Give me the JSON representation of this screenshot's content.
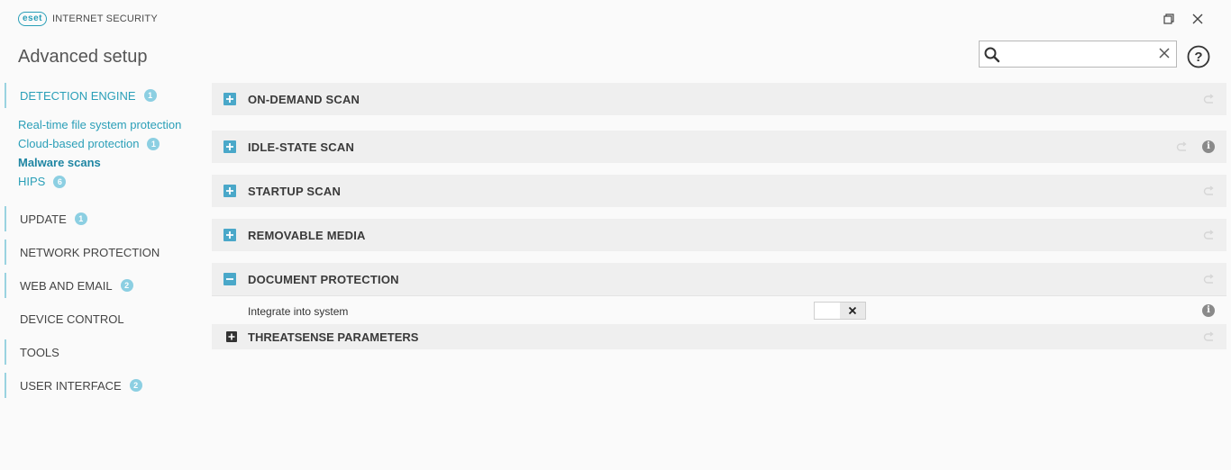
{
  "window": {
    "logo_text": "eset",
    "product_name": "INTERNET SECURITY"
  },
  "header": {
    "title": "Advanced setup",
    "search_placeholder": ""
  },
  "sidebar": {
    "sections": [
      {
        "label": "DETECTION ENGINE",
        "badge": "1"
      },
      {
        "label": "UPDATE",
        "badge": "1"
      },
      {
        "label": "NETWORK PROTECTION",
        "badge": ""
      },
      {
        "label": "WEB AND EMAIL",
        "badge": "2"
      },
      {
        "label": "DEVICE CONTROL",
        "badge": ""
      },
      {
        "label": "TOOLS",
        "badge": ""
      },
      {
        "label": "USER INTERFACE",
        "badge": "2"
      }
    ],
    "detection_items": [
      {
        "label": "Real-time file system protection",
        "badge": ""
      },
      {
        "label": "Cloud-based protection",
        "badge": "1"
      },
      {
        "label": "Malware scans",
        "badge": ""
      },
      {
        "label": "HIPS",
        "badge": "6"
      }
    ]
  },
  "main": {
    "panels": [
      {
        "title": "ON-DEMAND SCAN",
        "expanded": false
      },
      {
        "title": "IDLE-STATE SCAN",
        "expanded": false
      },
      {
        "title": "STARTUP SCAN",
        "expanded": false
      },
      {
        "title": "REMOVABLE MEDIA",
        "expanded": false
      },
      {
        "title": "DOCUMENT PROTECTION",
        "expanded": true
      }
    ],
    "document_protection": {
      "setting_label": "Integrate into system",
      "setting_enabled": false,
      "subsection_title": "THREATSENSE PARAMETERS"
    }
  },
  "colors": {
    "accent": "#2a9fb8",
    "panel_bg": "#efefef",
    "toggle_blue": "#4aa8c9",
    "badge": "#8ccfe2"
  }
}
